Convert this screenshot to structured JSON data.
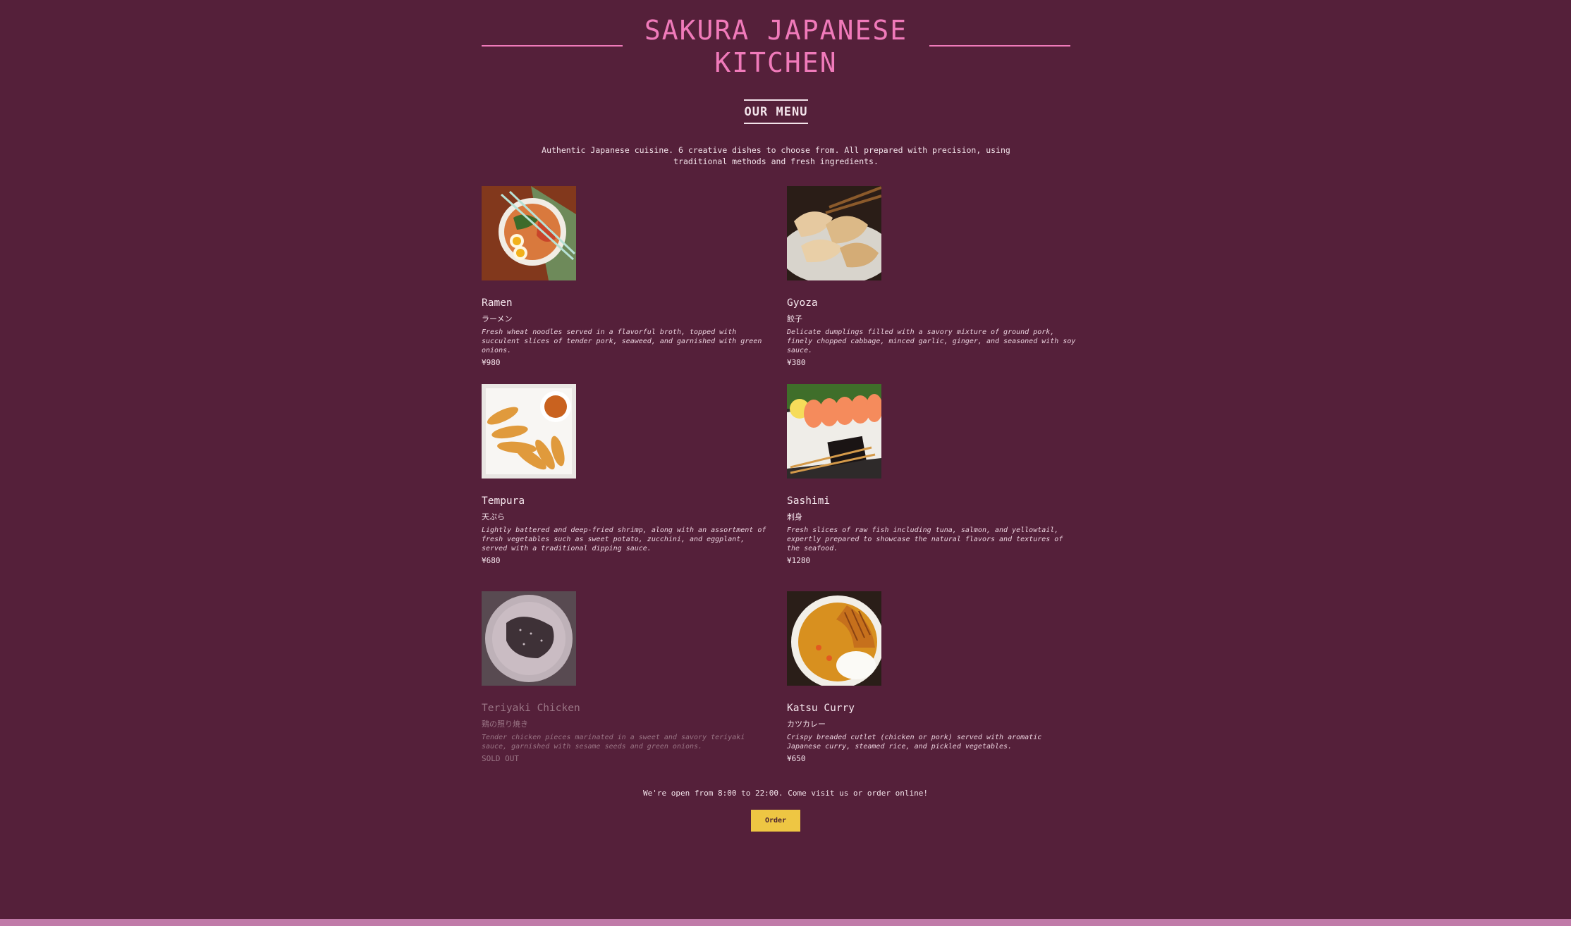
{
  "header": {
    "title": "SAKURA JAPANESE KITCHEN"
  },
  "menu": {
    "heading": "OUR MENU",
    "intro": "Authentic Japanese cuisine. 6 creative dishes to choose from. All prepared with precision, using traditional methods and fresh ingredients.",
    "items": [
      {
        "name": "Ramen",
        "jp": "ラーメン",
        "desc": "Fresh wheat noodles served in a flavorful broth, topped with succulent slices of tender pork, seaweed, and garnished with green onions.",
        "price": "¥980",
        "image": "ramen-image"
      },
      {
        "name": "Gyoza",
        "jp": "餃子",
        "desc": "Delicate dumplings filled with a savory mixture of ground pork, finely chopped cabbage, minced garlic, ginger, and seasoned with soy sauce.",
        "price": "¥380",
        "image": "gyoza-image"
      },
      {
        "name": "Tempura",
        "jp": "天ぷら",
        "desc": "Lightly battered and deep-fried shrimp, along with an assortment of fresh vegetables such as sweet potato, zucchini, and eggplant, served with a traditional dipping sauce.",
        "price": "¥680",
        "image": "tempura-image"
      },
      {
        "name": "Sashimi",
        "jp": "刺身",
        "desc": "Fresh slices of raw fish including tuna, salmon, and yellowtail, expertly prepared to showcase the natural flavors and textures of the seafood.",
        "price": "¥1280",
        "image": "sashimi-image"
      },
      {
        "name": "Teriyaki Chicken",
        "jp": "鶏の照り焼き",
        "desc": "Tender chicken pieces marinated in a sweet and savory teriyaki sauce, garnished with sesame seeds and green onions.",
        "price": "SOLD OUT",
        "image": "teriyaki-image"
      },
      {
        "name": "Katsu Curry",
        "jp": "カツカレー",
        "desc": "Crispy breaded cutlet (chicken or pork) served with aromatic Japanese curry, steamed rice, and pickled vegetables.",
        "price": "¥650",
        "image": "katsu-curry-image"
      }
    ]
  },
  "footer": {
    "hours_text": "We're open from 8:00 to 22:00. Come visit us or order online!",
    "order_label": "Order"
  },
  "colors": {
    "background": "#55203a",
    "accent": "#f07aba",
    "button": "#eec643",
    "bottom_bar": "#c07aa8"
  }
}
